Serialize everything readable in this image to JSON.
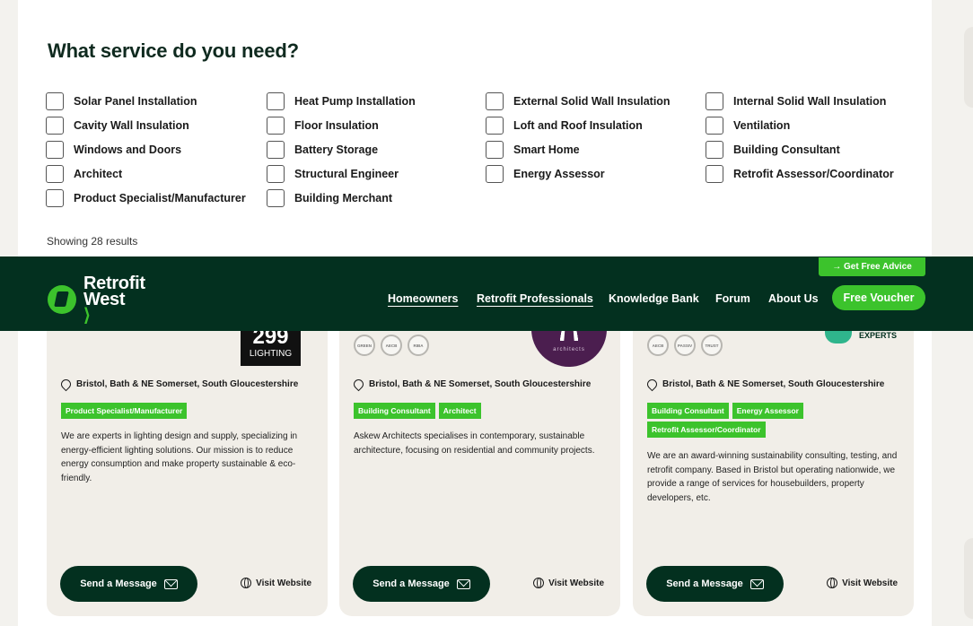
{
  "page": {
    "title": "What service do you need?",
    "results_text": "Showing 28 results"
  },
  "filters": [
    {
      "label": "Solar Panel Installation"
    },
    {
      "label": "Heat Pump Installation"
    },
    {
      "label": "External Solid Wall Insulation"
    },
    {
      "label": "Internal Solid Wall Insulation"
    },
    {
      "label": "Cavity Wall Insulation"
    },
    {
      "label": "Floor Insulation"
    },
    {
      "label": "Loft and Roof Insulation"
    },
    {
      "label": "Ventilation"
    },
    {
      "label": "Windows and Doors"
    },
    {
      "label": "Battery Storage"
    },
    {
      "label": "Smart Home"
    },
    {
      "label": "Building Consultant"
    },
    {
      "label": "Architect"
    },
    {
      "label": "Structural Engineer"
    },
    {
      "label": "Energy Assessor"
    },
    {
      "label": "Retrofit Assessor/Coordinator"
    },
    {
      "label": "Product Specialist/Manufacturer"
    },
    {
      "label": "Building Merchant"
    }
  ],
  "header": {
    "logo_line1": "Retrofit",
    "logo_line2": "West",
    "logo_accent": "⟩",
    "nav": [
      "Homeowners",
      "Retrofit Professionals",
      "Knowledge Bank",
      "Forum",
      "About Us"
    ],
    "advice_button": "→ Get Free Advice",
    "voucher_button": "Free Voucher"
  },
  "cards": [
    {
      "logo_num": "299",
      "logo_word": "LIGHTING",
      "location": "Bristol, Bath & NE Somerset, South Gloucestershire",
      "tags": [
        "Product Specialist/Manufacturer"
      ],
      "description": "We are experts in lighting design and supply, specializing in energy-efficient lighting solutions. Our mission is to reduce energy consumption and make property sustainable & eco-friendly.",
      "message_button": "Send a Message",
      "website_link": "Visit Website"
    },
    {
      "badges": [
        "GREEN",
        "AECB",
        "RIBA"
      ],
      "logo_word": "architects",
      "location": "Bristol, Bath & NE Somerset, South Gloucestershire",
      "tags": [
        "Building Consultant",
        "Architect"
      ],
      "description": "Askew Architects specialises in contemporary, sustainable architecture, focusing on residential and community projects.",
      "message_button": "Send a Message",
      "website_link": "Visit Website"
    },
    {
      "badges": [
        "AECB",
        "PASSIV",
        "TRUST"
      ],
      "logo_word": "EXPERTS",
      "location": "Bristol, Bath & NE Somerset, South Gloucestershire",
      "tags": [
        "Building Consultant",
        "Energy Assessor",
        "Retrofit Assessor/Coordinator"
      ],
      "description": "We are an award-winning sustainability consulting, testing, and retrofit company. Based in Bristol but operating nationwide, we provide a range of services for housebuilders, property developers, etc.",
      "message_button": "Send a Message",
      "website_link": "Visit Website"
    }
  ],
  "colors": {
    "brand_dark": "#03301f",
    "brand_green": "#3cc32c",
    "card_bg": "#f1eee8"
  }
}
